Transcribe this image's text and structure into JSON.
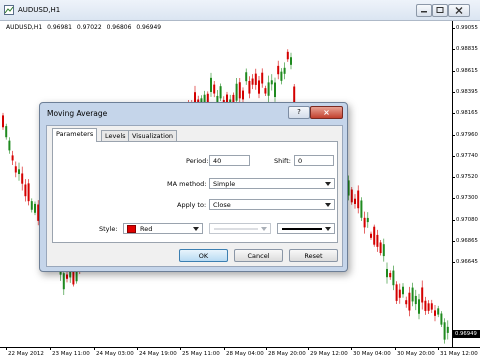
{
  "window": {
    "title": "AUDUSD,H1",
    "info": {
      "symbol": "AUDUSD,H1",
      "open": "0.96981",
      "high": "0.97022",
      "low": "0.96806",
      "close": "0.96949"
    }
  },
  "price_axis": {
    "labels": [
      "0.99055",
      "0.98835",
      "0.98615",
      "0.98395",
      "0.98165",
      "0.97960",
      "0.97740",
      "0.97520",
      "0.97300",
      "0.97080",
      "0.96865",
      "0.96645"
    ],
    "current_price": "0.96949"
  },
  "time_axis": {
    "labels": [
      "22 May 2012",
      "23 May 11:00",
      "24 May 03:00",
      "24 May 19:00",
      "25 May 11:00",
      "28 May 04:00",
      "28 May 20:00",
      "29 May 12:00",
      "30 May 04:00",
      "30 May 20:00",
      "31 May 12:00"
    ]
  },
  "dialog": {
    "title": "Moving Average",
    "help_label": "?",
    "close_label": "×",
    "tabs": [
      "Parameters",
      "Levels",
      "Visualization"
    ],
    "active_tab": "Parameters",
    "period_label": "Period:",
    "period_value": "40",
    "shift_label": "Shift:",
    "shift_value": "0",
    "ma_method_label": "MA method:",
    "ma_method_value": "Simple",
    "apply_to_label": "Apply to:",
    "apply_to_value": "Close",
    "style_label": "Style:",
    "style_color_name": "Red",
    "style_color": "#e00000",
    "ok_label": "OK",
    "cancel_label": "Cancel",
    "reset_label": "Reset"
  },
  "colors": {
    "bull": "#1f8a1f",
    "bear": "#d40000"
  }
}
